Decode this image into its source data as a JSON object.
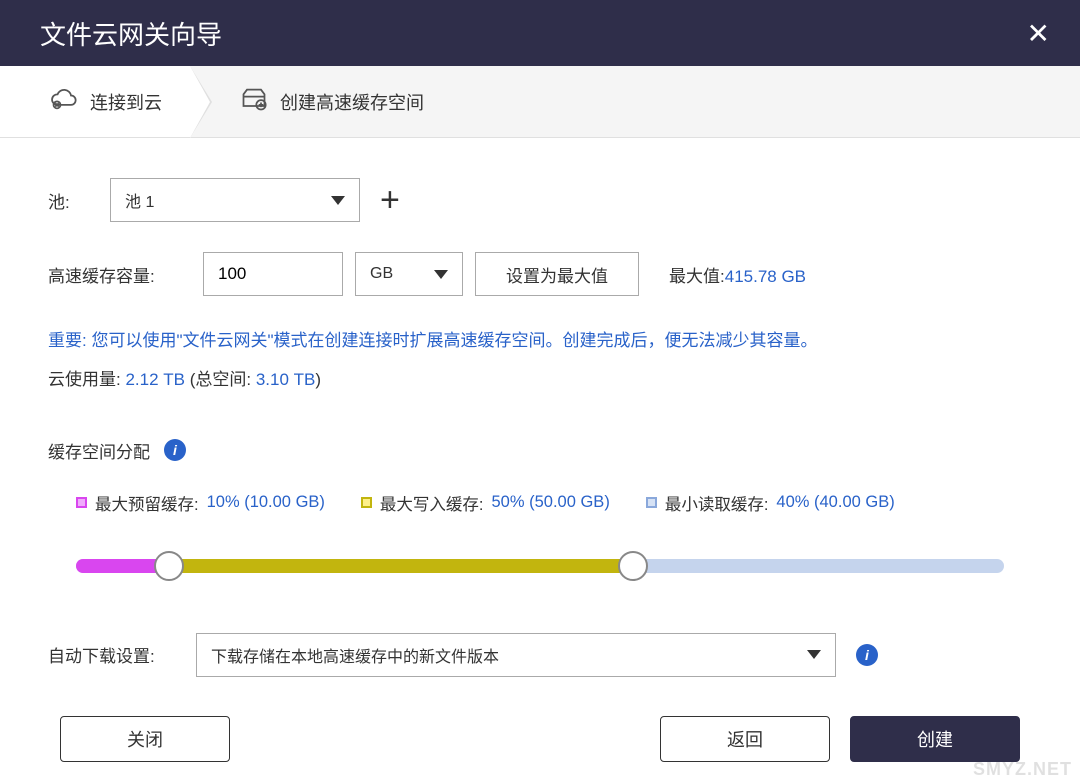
{
  "header": {
    "title": "文件云网关向导",
    "close_aria": "关闭"
  },
  "steps": {
    "s1": "连接到云",
    "s2": "创建高速缓存空间"
  },
  "pool": {
    "label": "池:",
    "selected": "池 1",
    "add_aria": "添加池"
  },
  "capacity": {
    "label": "高速缓存容量:",
    "value": "100",
    "unit": "GB",
    "set_max_btn": "设置为最大值",
    "max_label": "最大值:",
    "max_value": "415.78 GB"
  },
  "note": {
    "prefix": "重要: ",
    "text": "您可以使用\"文件云网关\"模式在创建连接时扩展高速缓存空间。创建完成后，便无法减少其容量。"
  },
  "usage": {
    "prefix": "云使用量: ",
    "used": "2.12 TB",
    "mid": " (总空间: ",
    "total": "3.10 TB",
    "suffix": ")"
  },
  "alloc": {
    "title": "缓存空间分配",
    "reserved_label": "最大预留缓存: ",
    "reserved_value": "10% (10.00 GB)",
    "write_label": "最大写入缓存: ",
    "write_value": "50% (50.00 GB)",
    "read_label": "最小读取缓存: ",
    "read_value": "40% (40.00 GB)"
  },
  "download": {
    "label": "自动下载设置:",
    "selected": "下载存储在本地高速缓存中的新文件版本"
  },
  "footer": {
    "close": "关闭",
    "back": "返回",
    "create": "创建"
  },
  "watermark": "SMYZ.NET"
}
